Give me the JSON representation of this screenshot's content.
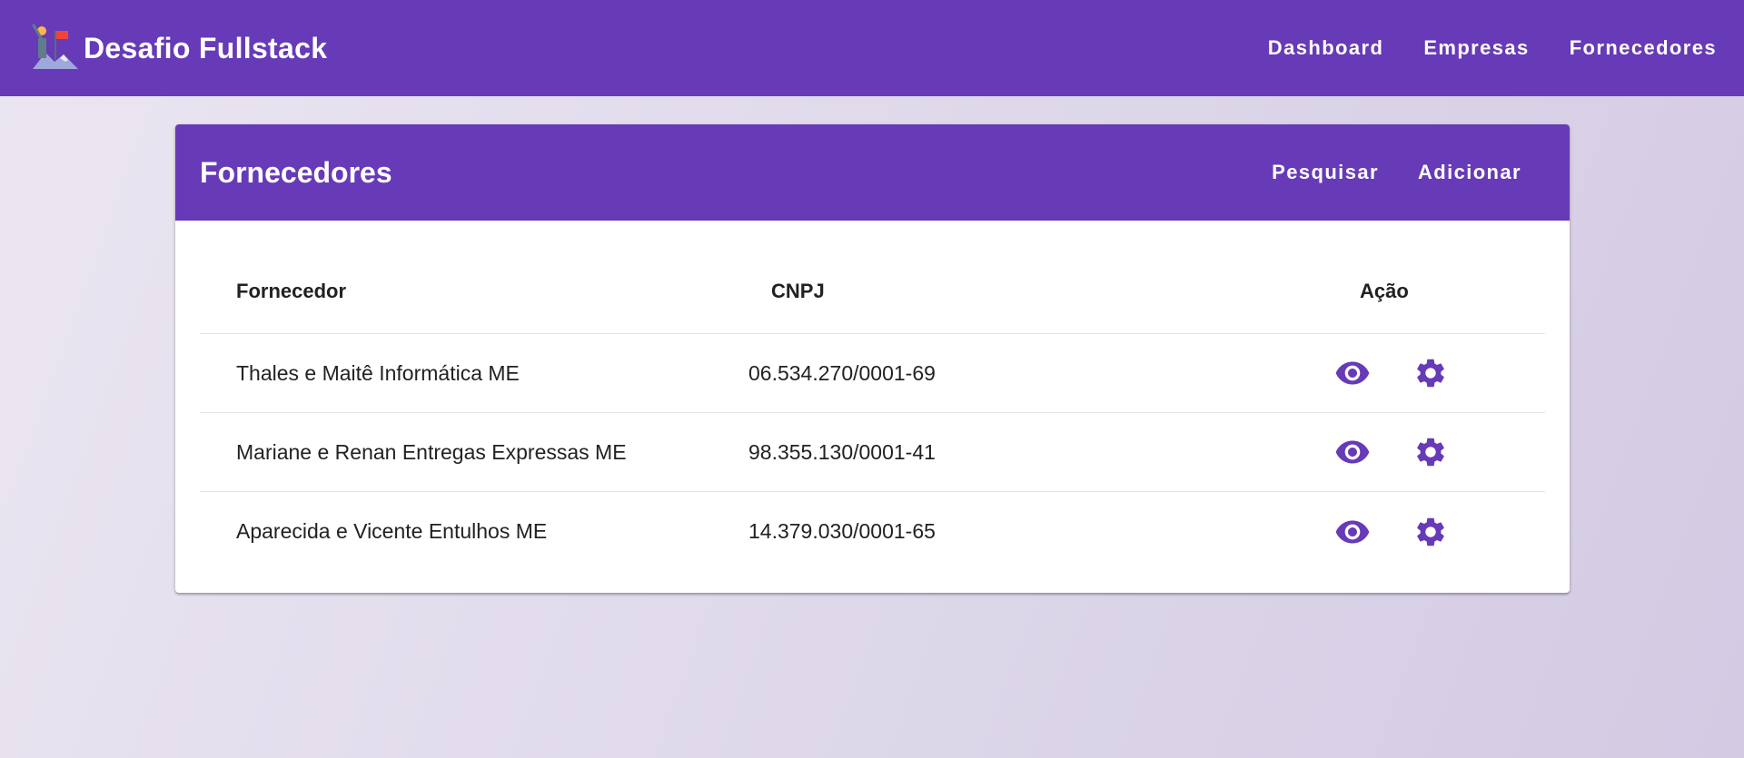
{
  "app": {
    "title": "Desafio Fullstack",
    "nav": [
      "Dashboard",
      "Empresas",
      "Fornecedores"
    ]
  },
  "page": {
    "title": "Fornecedores",
    "actions": {
      "search": "Pesquisar",
      "add": "Adicionar"
    }
  },
  "table": {
    "headers": {
      "name": "Fornecedor",
      "cnpj": "CNPJ",
      "action": "Ação"
    },
    "rows": [
      {
        "name": "Thales e Maitê Informática ME",
        "cnpj": "06.534.270/0001-69"
      },
      {
        "name": "Mariane e Renan Entregas Expressas ME",
        "cnpj": "98.355.130/0001-41"
      },
      {
        "name": "Aparecida e Vicente Entulhos ME",
        "cnpj": "14.379.030/0001-65"
      }
    ],
    "row_icons": [
      "eye-icon",
      "gear-icon"
    ]
  },
  "colors": {
    "primary": "#673ab7"
  }
}
